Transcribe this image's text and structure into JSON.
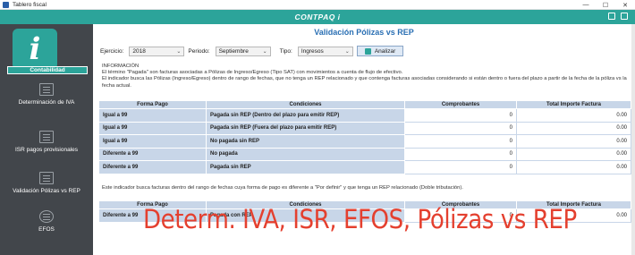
{
  "window": {
    "title": "Tablero fiscal",
    "minimize": "—",
    "maximize": "☐",
    "close": "✕"
  },
  "header": {
    "brand": "CONTPAQ i"
  },
  "sidebar": {
    "module": "Contabilidad",
    "items": [
      {
        "label": "Determinación de IVA"
      },
      {
        "label": "ISR pagos provisionales"
      },
      {
        "label": "Validación Pólizas vs REP"
      },
      {
        "label": "EFOS"
      }
    ]
  },
  "main": {
    "title": "Validación Pólizas vs REP",
    "filters": {
      "ejercicio_label": "Ejercicio:",
      "ejercicio_value": "2018",
      "periodo_label": "Periodo:",
      "periodo_value": "Septiembre",
      "tipo_label": "Tipo:",
      "tipo_value": "Ingresos",
      "analizar_label": "Analizar"
    },
    "info": {
      "heading": "INFORMACIÓN",
      "line1": "El término \"Pagada\" son facturas asociadas a Pólizas de Ingreso/Egreso (Tipo SAT) con movimientos a cuenta de flujo de efectivo.",
      "line2": "El indicador busca las Pólizas (Ingreso/Egreso) dentro de rango de fechas, que no tenga un REP relacionado y que contenga facturas asociadas considerando si están dentro o fuera del plazo a partir de la fecha de la póliza vs la",
      "line3": "fecha actual."
    },
    "table1": {
      "headers": [
        "Forma Pago",
        "Condiciones",
        "Comprobantes",
        "Total Importe Factura"
      ],
      "rows": [
        {
          "forma": "Igual a 99",
          "cond": "Pagada sin REP (Dentro del plazo para emitir REP)",
          "comp": "0",
          "total": "0.00"
        },
        {
          "forma": "Igual a 99",
          "cond": "Pagada sin REP (Fuera del plazo para emitir REP)",
          "comp": "0",
          "total": "0.00"
        },
        {
          "forma": "Igual a 99",
          "cond": "No pagada sin REP",
          "comp": "0",
          "total": "0.00"
        },
        {
          "forma": "Diferente a 99",
          "cond": "No pagada",
          "comp": "0",
          "total": "0.00"
        },
        {
          "forma": "Diferente a 99",
          "cond": "Pagada sin REP",
          "comp": "0",
          "total": "0.00"
        }
      ]
    },
    "info2": "Este indicador busca facturas dentro del rango de fechas cuya forma de pago es diferente a \"Por definir\" y que tenga un REP relacionado (Doble tributación).",
    "table2": {
      "headers": [
        "Forma Pago",
        "Condiciones",
        "Comprobantes",
        "Total Importe Factura"
      ],
      "rows": [
        {
          "forma": "Diferente a 99",
          "cond": "Pagada con REP",
          "comp": "0",
          "total": "0.00"
        }
      ]
    }
  },
  "overlay": "Determ. IVA, ISR, EFOS, Pólizas vs REP"
}
